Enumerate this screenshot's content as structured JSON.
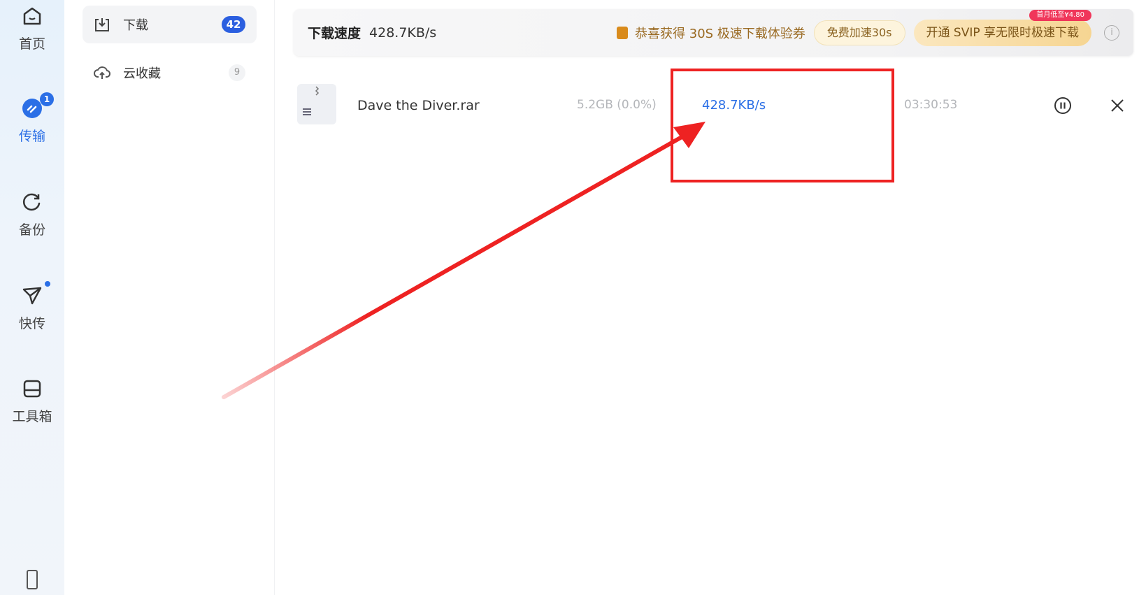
{
  "nav": {
    "items": [
      {
        "label": "首页",
        "icon": "home-icon"
      },
      {
        "label": "传输",
        "icon": "transfer-icon",
        "badge": "1",
        "active": true
      },
      {
        "label": "备份",
        "icon": "backup-icon"
      },
      {
        "label": "快传",
        "icon": "send-icon"
      },
      {
        "label": "工具箱",
        "icon": "toolbox-icon"
      }
    ],
    "bottom_icon": "phone-icon"
  },
  "subnav": {
    "items": [
      {
        "label": "下载",
        "count": "42",
        "active": true
      },
      {
        "label": "云收藏",
        "count": "9"
      }
    ]
  },
  "topbar": {
    "title": "下载速度",
    "speed": "428.7KB/s",
    "promo": "恭喜获得 30S 极速下载体验券",
    "free_boost": "免费加速30s",
    "svip": "开通 SVIP 享无限时极速下载",
    "svip_tag": "首月低至¥4.80",
    "info": "i"
  },
  "downloads": [
    {
      "name": "Dave the Diver.rar",
      "size": "5.2GB (0.0%)",
      "speed": "428.7KB/s",
      "remaining": "03:30:53"
    }
  ],
  "annotation": {
    "color": "#ee2222"
  },
  "colors": {
    "accent": "#2b6fe6"
  }
}
